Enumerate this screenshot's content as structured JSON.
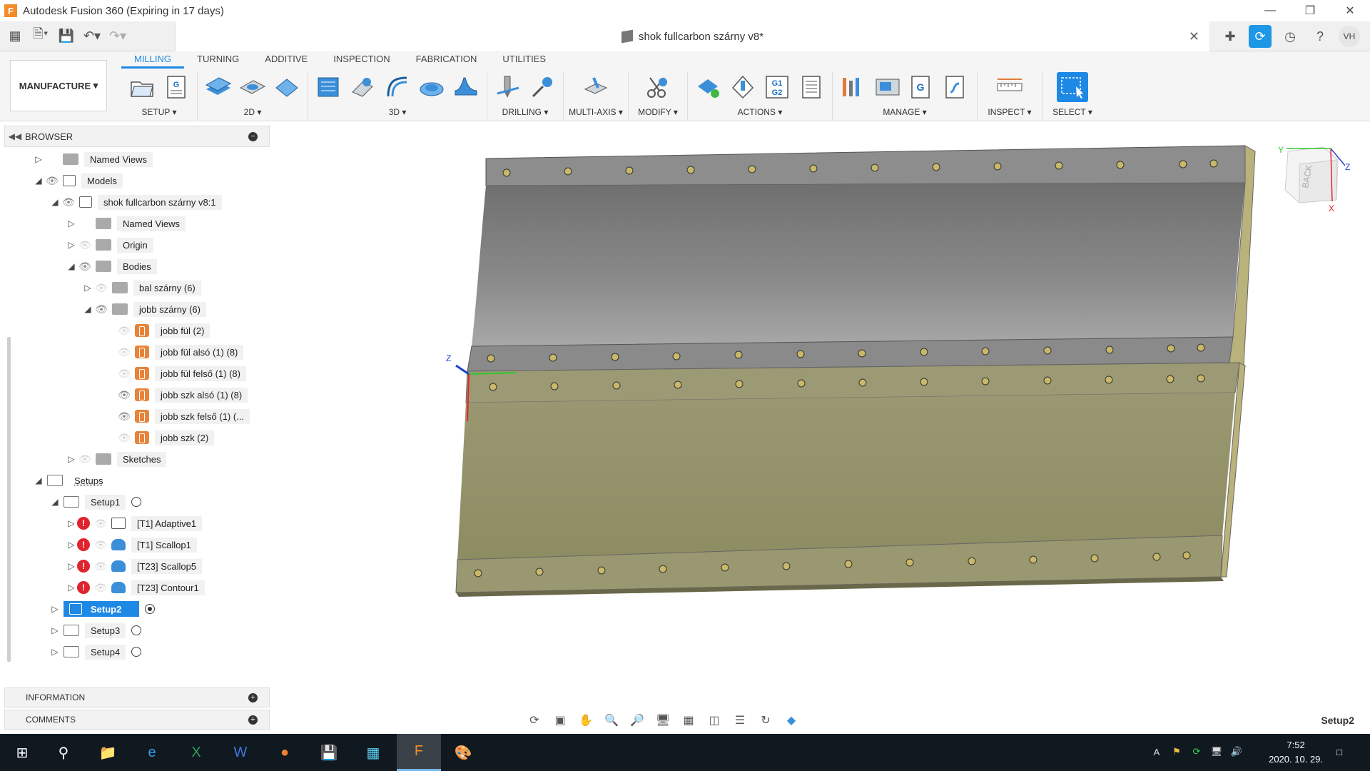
{
  "window": {
    "title": "Autodesk Fusion 360 (Expiring in 17 days)",
    "app_icon_letter": "F"
  },
  "document_tab": {
    "title": "shok fullcarbon szárny v8*"
  },
  "user": {
    "initials": "VH"
  },
  "ribbon": {
    "workspace": "MANUFACTURE",
    "tabs": [
      "MILLING",
      "TURNING",
      "ADDITIVE",
      "INSPECTION",
      "FABRICATION",
      "UTILITIES"
    ],
    "active_tab": "MILLING",
    "groups": {
      "setup": "SETUP",
      "twod": "2D",
      "threed": "3D",
      "drilling": "DRILLING",
      "multiaxis": "MULTI-AXIS",
      "modify": "MODIFY",
      "actions": "ACTIONS",
      "manage": "MANAGE",
      "inspect": "INSPECT",
      "select": "SELECT"
    },
    "actions_g1g2": "G1\nG2"
  },
  "browser": {
    "title": "BROWSER",
    "items": {
      "named_views_root": "Named Views",
      "models": "Models",
      "component": "shok fullcarbon szárny v8:1",
      "named_views": "Named Views",
      "origin": "Origin",
      "bodies": "Bodies",
      "bal_szarny": "bal szárny  (6)",
      "jobb_szarny": "jobb szárny  (6)",
      "jobb_ful": "jobb fül (2)",
      "jobb_ful_also": "jobb fül alsó (1) (8)",
      "jobb_ful_felso": "jobb fül felső (1) (8)",
      "jobb_szk_also": "jobb szk alsó (1) (8)",
      "jobb_szk_felso": "jobb szk felső  (1) (...",
      "jobb_szk": "jobb szk (2)",
      "sketches": "Sketches",
      "setups": "Setups",
      "setup1": "Setup1",
      "op_adaptive": "[T1] Adaptive1",
      "op_scallop1": "[T1] Scallop1",
      "op_scallop5": "[T23] Scallop5",
      "op_contour1": "[T23] Contour1",
      "setup2": "Setup2",
      "setup3": "Setup3",
      "setup4": "Setup4"
    }
  },
  "panels": {
    "information": "INFORMATION",
    "comments": "COMMENTS"
  },
  "viewcube": {
    "face": "BACK",
    "axis_x": "X",
    "axis_y": "Y",
    "axis_z": "Z"
  },
  "triad": {
    "z_label": "Z"
  },
  "status": {
    "active_setup": "Setup2"
  },
  "taskbar": {
    "time": "7:52",
    "date": "2020. 10. 29."
  },
  "colors": {
    "accent": "#1e88e5",
    "error": "#e0242e",
    "part_grey": "#7d7d7d",
    "part_olive": "#8f8d61",
    "taskbar": "#101820"
  }
}
